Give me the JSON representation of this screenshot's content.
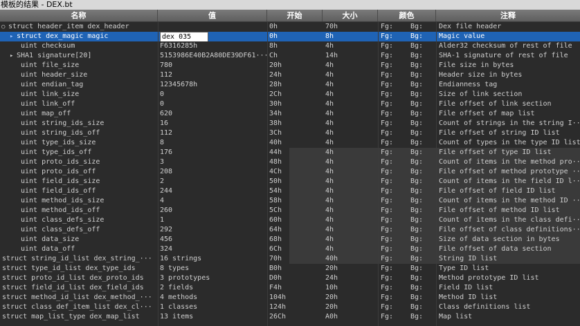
{
  "window": {
    "title": "模板的结果 - DEX.bt"
  },
  "columns": {
    "name": "名称",
    "value": "值",
    "start": "开始",
    "size": "大小",
    "color": "颜色",
    "comment": "注释"
  },
  "rows": [
    {
      "name": "struct header_item dex_header",
      "value": "",
      "start": "0h",
      "size": "70h",
      "fg": "Fg:",
      "bg": "Bg:",
      "comment": "Dex file header"
    },
    {
      "name": "struct dex_magic magic",
      "value": "dex 035",
      "start": "0h",
      "size": "8h",
      "fg": "Fg:",
      "bg": "Bg:",
      "comment": "Magic value"
    },
    {
      "name": "uint checksum",
      "value": "F6316285h",
      "start": "8h",
      "size": "4h",
      "fg": "Fg:",
      "bg": "Bg:",
      "comment": "Alder32 checksum of rest of file"
    },
    {
      "name": "SHA1 signature[20]",
      "value": "5153986E40B2A80DE39DF61···",
      "start": "Ch",
      "size": "14h",
      "fg": "Fg:",
      "bg": "Bg:",
      "comment": "SHA-1 signature of rest of file"
    },
    {
      "name": "uint file_size",
      "value": "780",
      "start": "20h",
      "size": "4h",
      "fg": "Fg:",
      "bg": "Bg:",
      "comment": "File size in bytes"
    },
    {
      "name": "uint header_size",
      "value": "112",
      "start": "24h",
      "size": "4h",
      "fg": "Fg:",
      "bg": "Bg:",
      "comment": "Header size in bytes"
    },
    {
      "name": "uint endian_tag",
      "value": "12345678h",
      "start": "28h",
      "size": "4h",
      "fg": "Fg:",
      "bg": "Bg:",
      "comment": "Endianness tag"
    },
    {
      "name": "uint link_size",
      "value": "0",
      "start": "2Ch",
      "size": "4h",
      "fg": "Fg:",
      "bg": "Bg:",
      "comment": "Size of link section"
    },
    {
      "name": "uint link_off",
      "value": "0",
      "start": "30h",
      "size": "4h",
      "fg": "Fg:",
      "bg": "Bg:",
      "comment": "File offset of link section"
    },
    {
      "name": "uint map_off",
      "value": "620",
      "start": "34h",
      "size": "4h",
      "fg": "Fg:",
      "bg": "Bg:",
      "comment": "File offset of map list"
    },
    {
      "name": "uint string_ids_size",
      "value": "16",
      "start": "38h",
      "size": "4h",
      "fg": "Fg:",
      "bg": "Bg:",
      "comment": "Count of strings in the string I···"
    },
    {
      "name": "uint string_ids_off",
      "value": "112",
      "start": "3Ch",
      "size": "4h",
      "fg": "Fg:",
      "bg": "Bg:",
      "comment": "File offset of string ID list"
    },
    {
      "name": "uint type_ids_size",
      "value": "8",
      "start": "40h",
      "size": "4h",
      "fg": "Fg:",
      "bg": "Bg:",
      "comment": "Count of types in the type ID list"
    },
    {
      "name": "uint type_ids_off",
      "value": "176",
      "start": "44h",
      "size": "4h",
      "fg": "Fg:",
      "bg": "Bg:",
      "comment": "File offset of type ID list"
    },
    {
      "name": "uint proto_ids_size",
      "value": "3",
      "start": "48h",
      "size": "4h",
      "fg": "Fg:",
      "bg": "Bg:",
      "comment": "Count of items in the method pro···"
    },
    {
      "name": "uint proto_ids_off",
      "value": "208",
      "start": "4Ch",
      "size": "4h",
      "fg": "Fg:",
      "bg": "Bg:",
      "comment": "File offset of method prototype ···"
    },
    {
      "name": "uint field_ids_size",
      "value": "2",
      "start": "50h",
      "size": "4h",
      "fg": "Fg:",
      "bg": "Bg:",
      "comment": "Count of items in the field ID l···"
    },
    {
      "name": "uint field_ids_off",
      "value": "244",
      "start": "54h",
      "size": "4h",
      "fg": "Fg:",
      "bg": "Bg:",
      "comment": "File offset of field ID list"
    },
    {
      "name": "uint method_ids_size",
      "value": "4",
      "start": "58h",
      "size": "4h",
      "fg": "Fg:",
      "bg": "Bg:",
      "comment": "Count of items in the method ID ···"
    },
    {
      "name": "uint method_ids_off",
      "value": "260",
      "start": "5Ch",
      "size": "4h",
      "fg": "Fg:",
      "bg": "Bg:",
      "comment": "File offset of method ID list"
    },
    {
      "name": "uint class_defs_size",
      "value": "1",
      "start": "60h",
      "size": "4h",
      "fg": "Fg:",
      "bg": "Bg:",
      "comment": "Count of items in the class defi···"
    },
    {
      "name": "uint class_defs_off",
      "value": "292",
      "start": "64h",
      "size": "4h",
      "fg": "Fg:",
      "bg": "Bg:",
      "comment": "File offset of class definitions···"
    },
    {
      "name": "uint data_size",
      "value": "456",
      "start": "68h",
      "size": "4h",
      "fg": "Fg:",
      "bg": "Bg:",
      "comment": "Size of data section in bytes"
    },
    {
      "name": "uint data_off",
      "value": "324",
      "start": "6Ch",
      "size": "4h",
      "fg": "Fg:",
      "bg": "Bg:",
      "comment": "File offset of data section"
    },
    {
      "name": "struct string_id_list dex_string_···",
      "value": "16 strings",
      "start": "70h",
      "size": "40h",
      "fg": "Fg:",
      "bg": "Bg:",
      "comment": "String ID list"
    },
    {
      "name": "struct type_id_list dex_type_ids",
      "value": "8 types",
      "start": "B0h",
      "size": "20h",
      "fg": "Fg:",
      "bg": "Bg:",
      "comment": "Type ID list"
    },
    {
      "name": "struct proto_id_list dex_proto_ids",
      "value": "3 prototypes",
      "start": "D0h",
      "size": "24h",
      "fg": "Fg:",
      "bg": "Bg:",
      "comment": "Method prototype ID list"
    },
    {
      "name": "struct field_id_list dex_field_ids",
      "value": "2 fields",
      "start": "F4h",
      "size": "10h",
      "fg": "Fg:",
      "bg": "Bg:",
      "comment": "Field ID list"
    },
    {
      "name": "struct method_id_list dex_method_···",
      "value": "4 methods",
      "start": "104h",
      "size": "20h",
      "fg": "Fg:",
      "bg": "Bg:",
      "comment": "Method ID list"
    },
    {
      "name": "struct class_def_item_list dex_cl···",
      "value": "1 classes",
      "start": "124h",
      "size": "20h",
      "fg": "Fg:",
      "bg": "Bg:",
      "comment": "Class definitions list"
    },
    {
      "name": "struct map_list_type dex_map_list",
      "value": "13 items",
      "start": "26Ch",
      "size": "A0h",
      "fg": "Fg:",
      "bg": "Bg:",
      "comment": "Map list"
    }
  ],
  "icons": {
    "expander": "expand-toggle-icon",
    "selected": "selected-row-arrow-icon",
    "sha_expander": "expand-array-icon"
  },
  "colors": {
    "selection": "#1f63b5",
    "background": "#2b2b2b",
    "header": "#6a6a6a",
    "text": "#d0d0d0"
  }
}
